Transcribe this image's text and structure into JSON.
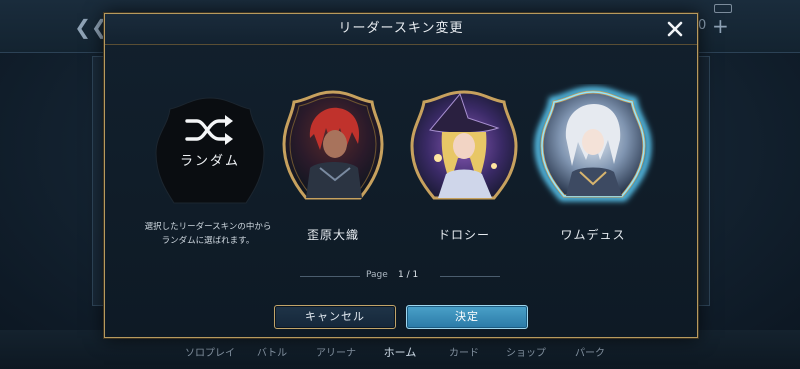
{
  "background": {
    "back_icon": "chevron-left-icon",
    "currency_value": "0",
    "nav": [
      {
        "label": "ソロプレイ",
        "active": false
      },
      {
        "label": "バトル",
        "active": false
      },
      {
        "label": "アリーナ",
        "active": false
      },
      {
        "label": "ホーム",
        "active": true
      },
      {
        "label": "カード",
        "active": false
      },
      {
        "label": "ショップ",
        "active": false
      },
      {
        "label": "パーク",
        "active": false
      }
    ]
  },
  "modal": {
    "title": "リーダースキン変更",
    "close_icon": "close-icon",
    "random": {
      "label": "ランダム",
      "icon": "shuffle-icon",
      "description_line1": "選択したリーダースキンの中から",
      "description_line2": "ランダムに選ばれます。"
    },
    "skins": [
      {
        "name": "歪原大織",
        "frame_color": "#c7a15e",
        "selected": false
      },
      {
        "name": "ドロシー",
        "frame_color": "#c7a15e",
        "selected": false
      },
      {
        "name": "ワムデュス",
        "frame_color": "#c7a15e",
        "selected": true
      }
    ],
    "pagination": {
      "label": "Page",
      "value": "1 / 1"
    },
    "buttons": {
      "cancel": "キャンセル",
      "confirm": "決定"
    }
  },
  "colors": {
    "accent_gold": "#b79a5e",
    "confirm_blue": "#3a8fba",
    "selection_glow": "#5fd3ff"
  }
}
